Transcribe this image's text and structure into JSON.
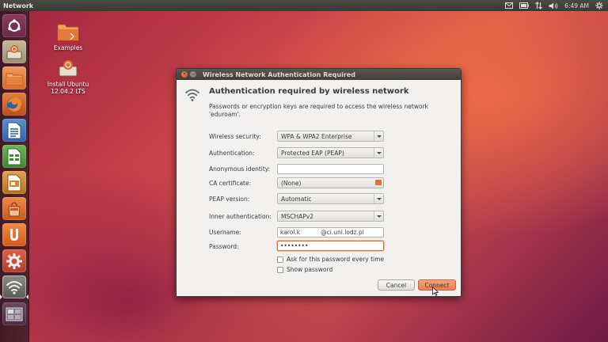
{
  "top_panel": {
    "app_title": "Network",
    "time": "6:49 AM",
    "indicators": [
      "mail-icon",
      "battery-icon",
      "network-updown-icon",
      "volume-icon",
      "gear-icon"
    ]
  },
  "launcher": {
    "items": [
      {
        "name": "dash-home",
        "icon": "ubuntu-logo-icon"
      },
      {
        "name": "ubuntu-installer",
        "icon": "installer-icon"
      },
      {
        "name": "files",
        "icon": "folder-icon"
      },
      {
        "name": "firefox",
        "icon": "firefox-icon"
      },
      {
        "name": "libreoffice-writer",
        "icon": "writer-icon"
      },
      {
        "name": "libreoffice-calc",
        "icon": "calc-icon"
      },
      {
        "name": "libreoffice-impress",
        "icon": "impress-icon"
      },
      {
        "name": "software-center",
        "icon": "shopping-bag-icon"
      },
      {
        "name": "ubuntu-one",
        "icon": "ubuntu-one-icon"
      },
      {
        "name": "system-settings",
        "icon": "gear-icon"
      },
      {
        "name": "network-manager",
        "icon": "wifi-icon"
      },
      {
        "name": "workspace-switcher",
        "icon": "workspace-icon"
      }
    ]
  },
  "desktop": {
    "icons": [
      {
        "label": "Examples"
      },
      {
        "label_line1": "Install Ubuntu",
        "label_line2": "12.04.2 LTS"
      }
    ]
  },
  "dialog": {
    "title": "Wireless Network Authentication Required",
    "heading": "Authentication required by wireless network",
    "description": "Passwords or encryption keys are required to access the wireless network 'eduroam'.",
    "fields": {
      "wireless_security": {
        "label": "Wireless security:",
        "value": "WPA & WPA2 Enterprise"
      },
      "authentication": {
        "label": "Authentication:",
        "value": "Protected EAP (PEAP)"
      },
      "anonymous_identity": {
        "label": "Anonymous identity:",
        "value": ""
      },
      "ca_certificate": {
        "label": "CA certificate:",
        "value": "(None)"
      },
      "peap_version": {
        "label": "PEAP version:",
        "value": "Automatic"
      },
      "inner_authentication": {
        "label": "Inner authentication:",
        "value": "MSCHAPv2"
      },
      "username": {
        "label": "Username:",
        "value_user": "karol.k",
        "value_domain": "@ci.uni.lodz.pl"
      },
      "password": {
        "label": "Password:",
        "value": "••••••••"
      }
    },
    "checkboxes": {
      "ask_password": {
        "label": "Ask for this password every time",
        "checked": false
      },
      "show_password": {
        "label": "Show password",
        "checked": false
      }
    },
    "buttons": {
      "cancel": "Cancel",
      "connect": "Connect"
    },
    "colors": {
      "accent": "#ee7d4e",
      "focus_border": "#e56b2f"
    }
  }
}
